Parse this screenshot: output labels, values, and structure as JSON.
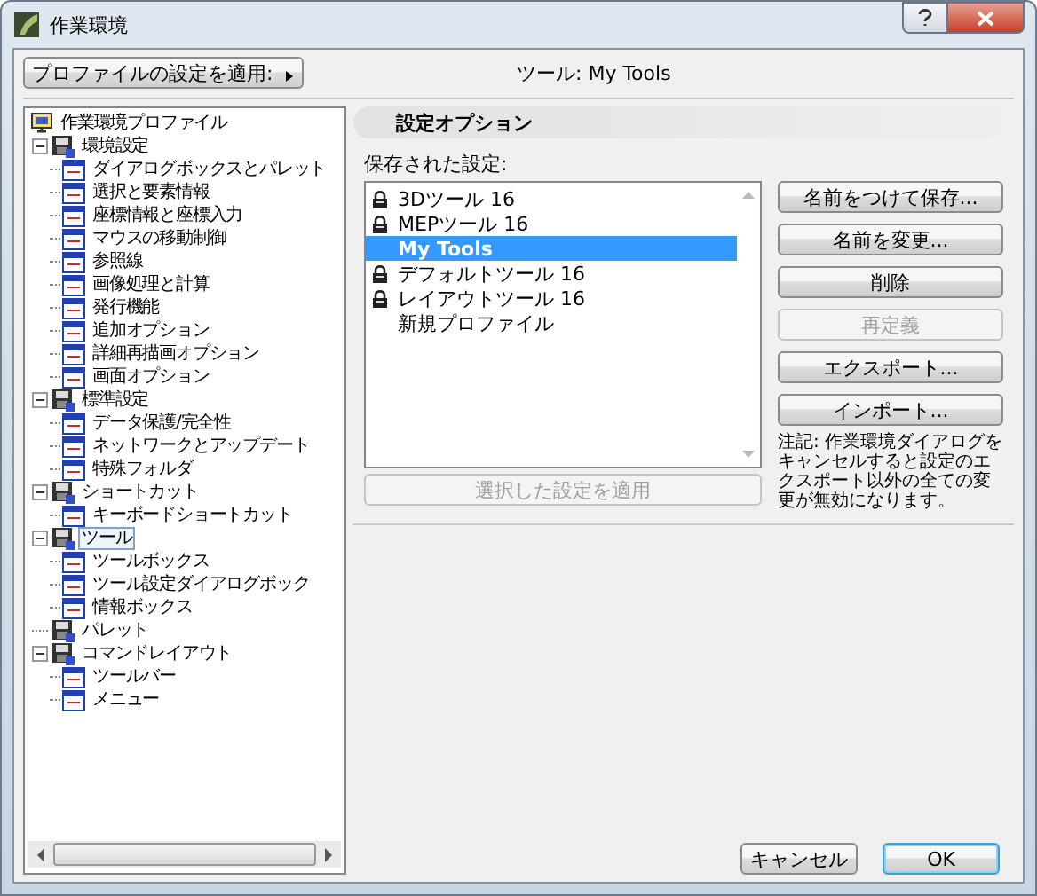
{
  "window": {
    "title": "作業環境"
  },
  "profile_button": {
    "label": "プロファイルの設定を適用:"
  },
  "current_profile": "ツール: My Tools",
  "tree": [
    {
      "label": "作業環境プロファイル",
      "selected": false,
      "children": [
        {
          "label": "環境設定",
          "selected": false,
          "expanded": true,
          "children": [
            {
              "label": "ダイアログボックスとパレット",
              "selected": false
            },
            {
              "label": "選択と要素情報",
              "selected": false
            },
            {
              "label": "座標情報と座標入力",
              "selected": false
            },
            {
              "label": "マウスの移動制御",
              "selected": false
            },
            {
              "label": "参照線",
              "selected": false
            },
            {
              "label": "画像処理と計算",
              "selected": false
            },
            {
              "label": "発行機能",
              "selected": false
            },
            {
              "label": "追加オプション",
              "selected": false
            },
            {
              "label": "詳細再描画オプション",
              "selected": false
            },
            {
              "label": "画面オプション",
              "selected": false
            }
          ]
        },
        {
          "label": "標準設定",
          "selected": false,
          "expanded": true,
          "children": [
            {
              "label": "データ保護/完全性",
              "selected": false
            },
            {
              "label": "ネットワークとアップデート",
              "selected": false
            },
            {
              "label": "特殊フォルダ",
              "selected": false
            }
          ]
        },
        {
          "label": "ショートカット",
          "selected": false,
          "expanded": true,
          "children": [
            {
              "label": "キーボードショートカット",
              "selected": false
            }
          ]
        },
        {
          "label": "ツール",
          "selected": true,
          "expanded": true,
          "children": [
            {
              "label": "ツールボックス",
              "selected": false
            },
            {
              "label": "ツール設定ダイアログボック",
              "selected": false
            },
            {
              "label": "情報ボックス",
              "selected": false
            }
          ]
        },
        {
          "label": "パレット",
          "selected": false
        },
        {
          "label": "コマンドレイアウト",
          "selected": false,
          "expanded": true,
          "children": [
            {
              "label": "ツールバー",
              "selected": false
            },
            {
              "label": "メニュー",
              "selected": false
            }
          ]
        }
      ]
    }
  ],
  "options": {
    "heading": "設定オプション",
    "saved_label": "保存された設定:",
    "saved": [
      {
        "label": "3Dツール 16",
        "locked": true,
        "selected": false
      },
      {
        "label": "MEPツール 16",
        "locked": true,
        "selected": false
      },
      {
        "label": "My Tools",
        "locked": false,
        "selected": true
      },
      {
        "label": "デフォルトツール 16",
        "locked": true,
        "selected": false
      },
      {
        "label": "レイアウトツール 16",
        "locked": true,
        "selected": false
      },
      {
        "label": "新規プロファイル",
        "locked": false,
        "selected": false
      }
    ],
    "buttons": [
      {
        "label": "名前をつけて保存...",
        "disabled": false
      },
      {
        "label": "名前を変更...",
        "disabled": false
      },
      {
        "label": "削除",
        "disabled": false
      },
      {
        "label": "再定義",
        "disabled": true
      },
      {
        "label": "エクスポート...",
        "disabled": false
      },
      {
        "label": "インポート...",
        "disabled": false
      }
    ],
    "note": "注記: 作業環境ダイアログをキャンセルすると設定のエクスポート以外の全ての変更が無効になります。",
    "apply_button": {
      "label": "選択した設定を適用",
      "disabled": true
    }
  },
  "footer_buttons": [
    {
      "label": "キャンセル",
      "default": false
    },
    {
      "label": "OK",
      "default": true
    }
  ]
}
